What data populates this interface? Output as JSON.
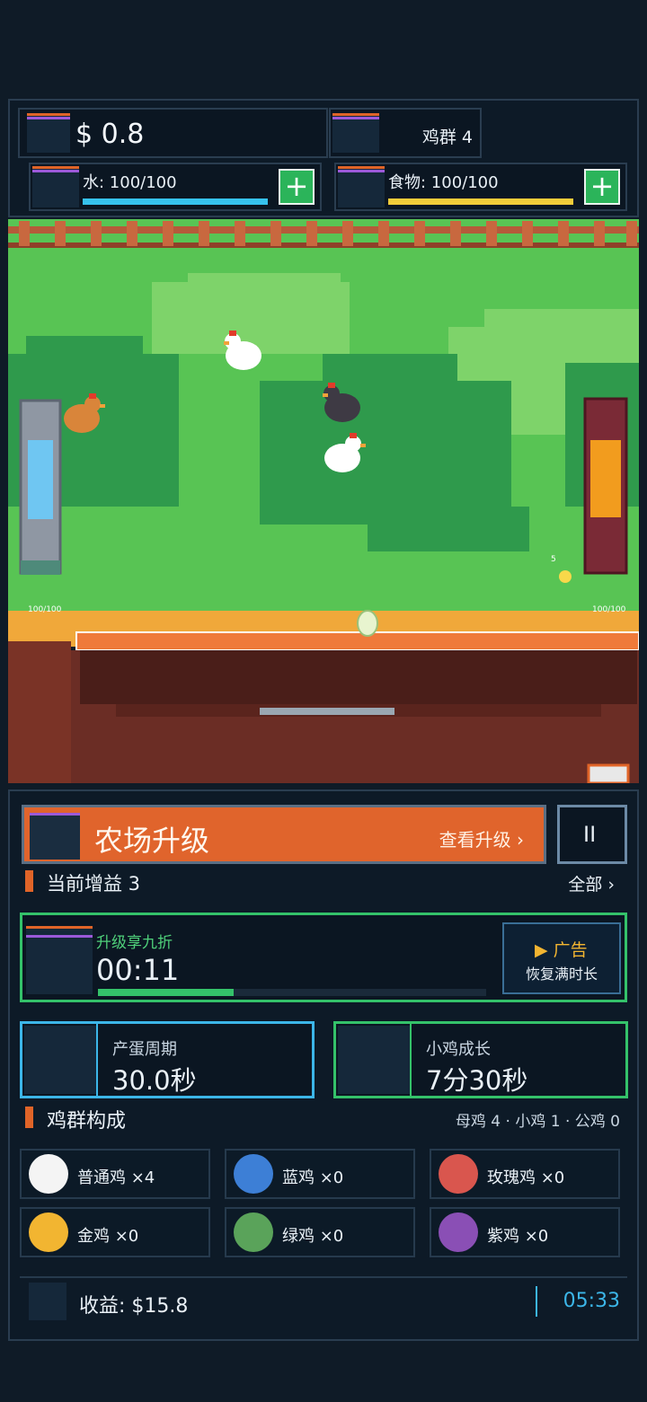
{
  "top": {
    "money": "$ 0.8",
    "flock": "鸡群 4",
    "water": "水: 100/100",
    "water_fill": 1.0,
    "food": "食物: 100/100",
    "food_fill": 1.0,
    "water_add": "+",
    "food_add": "+"
  },
  "field": {
    "water_level": "100/100",
    "food_level": "100/100",
    "chick_count": "5"
  },
  "upgrade": {
    "title": "农场升级",
    "link": "查看升级 ›",
    "pause": "II"
  },
  "boosts": {
    "label": "当前增益 3",
    "all": "全部 ›"
  },
  "offer": {
    "title": "升级享九折",
    "timer": "00:11",
    "progress": 0.35,
    "ad_label": "▶ 广告",
    "ad_sub": "恢复满时长"
  },
  "stats": {
    "egg_label": "产蛋周期",
    "egg_value": "30.0秒",
    "chick_label": "小鸡成长",
    "chick_value": "7分30秒"
  },
  "composition": {
    "title": "鸡群构成",
    "summary": "母鸡 4 · 小鸡 1 · 公鸡 0",
    "breeds": [
      {
        "name": "普通鸡 ×4",
        "color": "#f4f4f4"
      },
      {
        "name": "蓝鸡 ×0",
        "color": "#3d7fd6"
      },
      {
        "name": "玫瑰鸡 ×0",
        "color": "#d9564e"
      },
      {
        "name": "金鸡 ×0",
        "color": "#f2b531"
      },
      {
        "name": "绿鸡 ×0",
        "color": "#5aa35a"
      },
      {
        "name": "紫鸡 ×0",
        "color": "#8a4fb5"
      }
    ]
  },
  "footer": {
    "income": "收益: $15.8",
    "time": "05:33"
  },
  "colors": {
    "accent_orange": "#e06428",
    "accent_green": "#34c26a",
    "accent_blue": "#3cb6e8",
    "water_bar": "#36c2ee",
    "food_bar": "#f2cc3a"
  }
}
